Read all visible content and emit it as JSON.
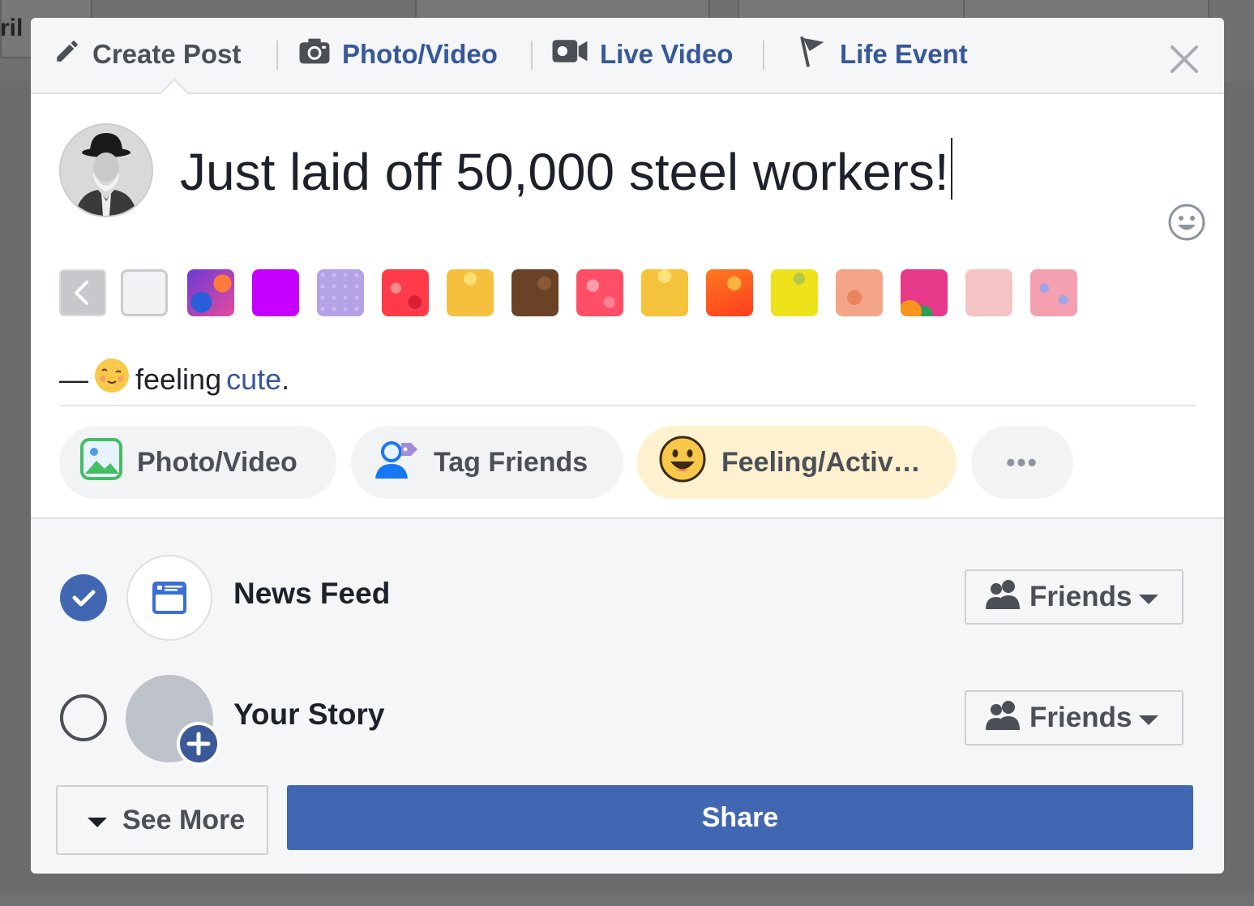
{
  "background": {
    "fragment_text": "ril"
  },
  "tabs": {
    "create_post": "Create Post",
    "photo_video": "Photo/Video",
    "live_video": "Live Video",
    "life_event": "Life Event",
    "close_icon": "close-icon"
  },
  "composer": {
    "post_text": "Just laid off 50,000 steel workers!",
    "avatar": "avatar",
    "emoji_icon": "smiley-icon"
  },
  "backgrounds": {
    "colors": [
      "#f1f2f4",
      "#5b55c9",
      "#c600ff",
      "#b3a3e6",
      "#ff3b4a",
      "#f5c03d",
      "#6a4327",
      "#ff4f67",
      "#f4c23b",
      "#ff5a22",
      "#eee21a",
      "#f5a587",
      "#e6398a",
      "#f4c4c4",
      "#f5a0b0"
    ]
  },
  "feeling": {
    "prefix": "—",
    "verb": "feeling",
    "value": "cute",
    "suffix": "."
  },
  "actions": {
    "photo_video": "Photo/Video",
    "tag_friends": "Tag Friends",
    "feeling_activity": "Feeling/Activ…",
    "more": "•••"
  },
  "audience": {
    "news_feed": {
      "label": "News Feed",
      "checked": true,
      "privacy": "Friends"
    },
    "your_story": {
      "label": "Your Story",
      "checked": false,
      "privacy": "Friends"
    }
  },
  "footer": {
    "see_more": "See More",
    "share": "Share"
  },
  "colors": {
    "accent": "#4267b2",
    "link": "#365899",
    "feeling_pill": "#fef1cf"
  }
}
